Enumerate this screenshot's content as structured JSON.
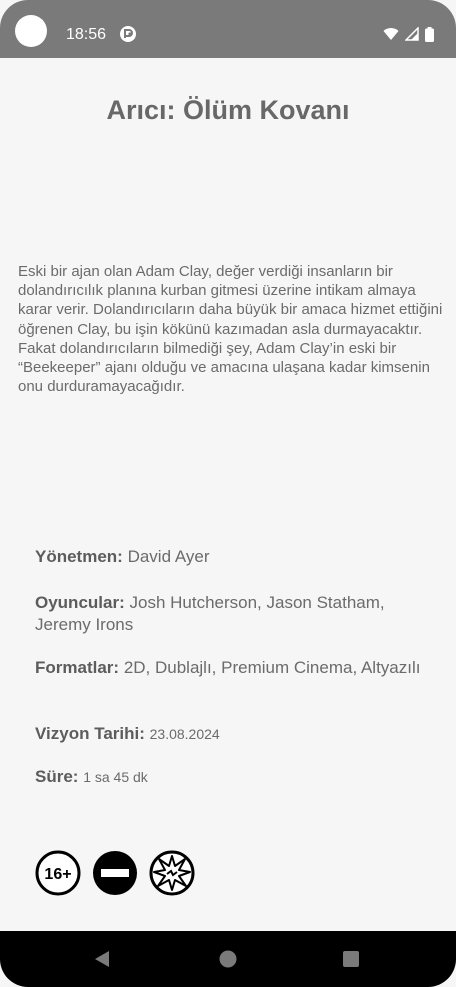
{
  "status_bar": {
    "time": "18:56"
  },
  "movie": {
    "title": "Arıcı: Ölüm Kovanı",
    "synopsis": "Eski bir ajan olan Adam Clay, değer verdiği insanların bir dolandırıcılık planına kurban gitmesi üzerine intikam almaya karar verir. Dolandırıcıların daha büyük bir amaca hizmet ettiğini öğrenen Clay, bu işin kökünü kazımadan asla durmayacaktır. Fakat dolandırıcıların bilmediği şey, Adam Clay’in eski bir “Beekeeper” ajanı olduğu ve amacına ulaşana kadar kimsenin onu durduramayacağıdır.",
    "director_label": "Yönetmen:",
    "director": "David Ayer",
    "cast_label": "Oyuncular:",
    "cast": "Josh Hutcherson, Jason Statham, Jeremy Irons",
    "formats_label": "Formatlar:",
    "formats": "2D, Dublajlı, Premium Cinema, Altyazılı",
    "release_label": "Vizyon Tarihi:",
    "release_date": "23.08.2024",
    "duration_label": "Süre:",
    "duration": "1 sa 45 dk",
    "rating_badges": [
      {
        "icon": "age-16-plus-icon",
        "text": "16+"
      },
      {
        "icon": "no-entry-icon"
      },
      {
        "icon": "violence-icon"
      }
    ]
  },
  "nav_bar": {
    "buttons": [
      "back-icon",
      "home-icon",
      "recents-icon"
    ]
  },
  "colors": {
    "status_bar": "#7a7a7a",
    "background": "#f6f6f6",
    "text": "#6b6b6b",
    "nav_bar": "#000000"
  }
}
